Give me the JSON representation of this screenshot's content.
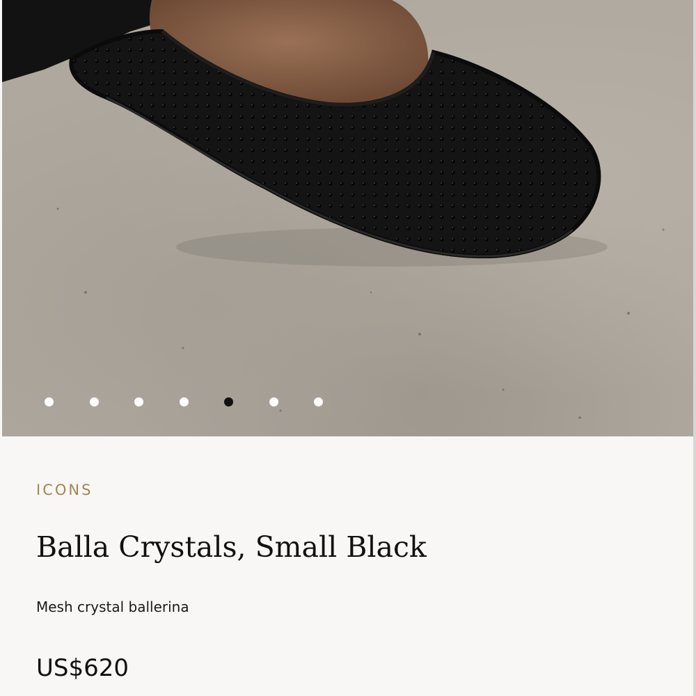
{
  "gallery": {
    "image_alt": "Balla Crystals, Small Black",
    "slide_count": 7,
    "active_index": 4
  },
  "product": {
    "collection": "ICONS",
    "title": "Balla Crystals, Small Black",
    "subtitle": "Mesh crystal ballerina",
    "price": "US$620"
  },
  "colors": {
    "accent": "#a08652",
    "background": "#f8f7f5",
    "text": "#111111"
  }
}
